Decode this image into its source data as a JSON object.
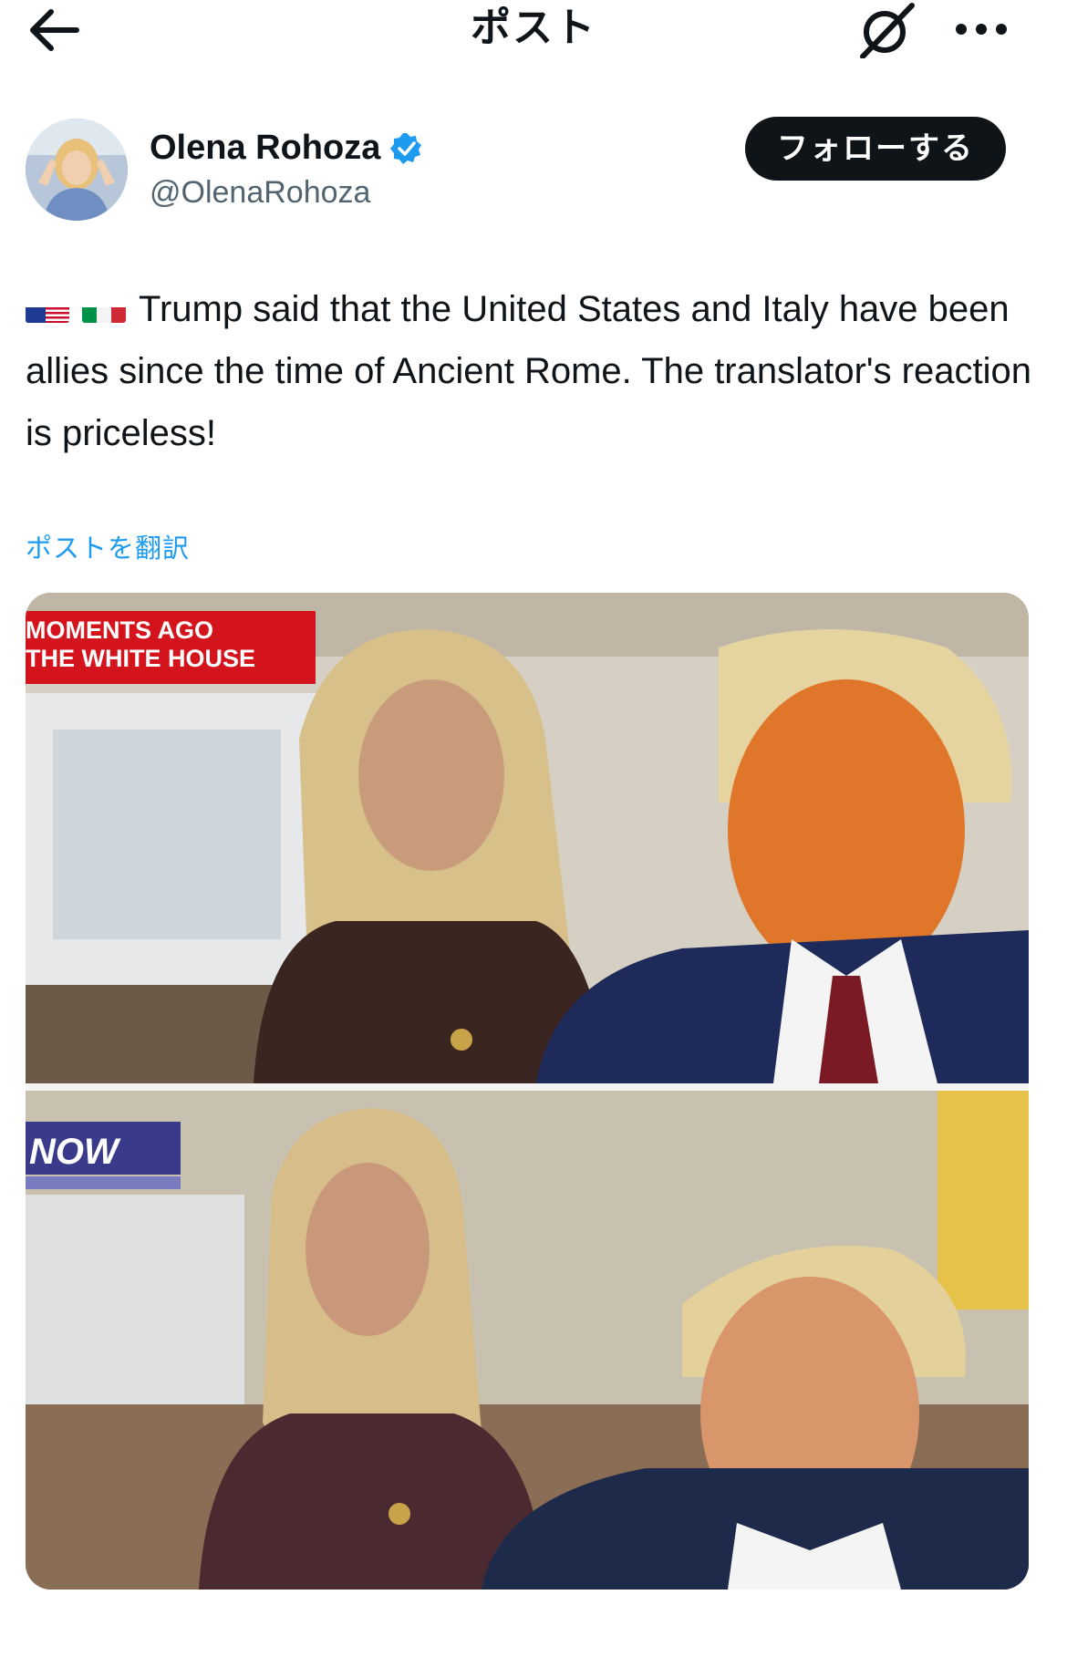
{
  "header": {
    "title": "ポスト",
    "back_icon": "arrow-left-icon",
    "grok_icon": "grok-slash-icon",
    "more_icon": "ellipsis-icon"
  },
  "author": {
    "name": "Olena Rohoza",
    "handle": "@OlenaRohoza",
    "verified": true,
    "verified_color": "#1d9bf0",
    "follow_label": "フォローする"
  },
  "post": {
    "flags": [
      "us-flag-icon",
      "italy-flag-icon"
    ],
    "text": "Trump said that the United States and Italy have been allies since the time of Ancient Rome. The translator's reaction is priceless!",
    "translate_label": "ポストを翻訳"
  },
  "media": {
    "top_chyron_line1": "MOMENTS AGO",
    "top_chyron_line2": "THE WHITE HOUSE",
    "bottom_logo": "NOW"
  },
  "colors": {
    "link": "#1d9bf0",
    "follow_bg": "#0f1419",
    "chyron_red": "#d4141c"
  }
}
